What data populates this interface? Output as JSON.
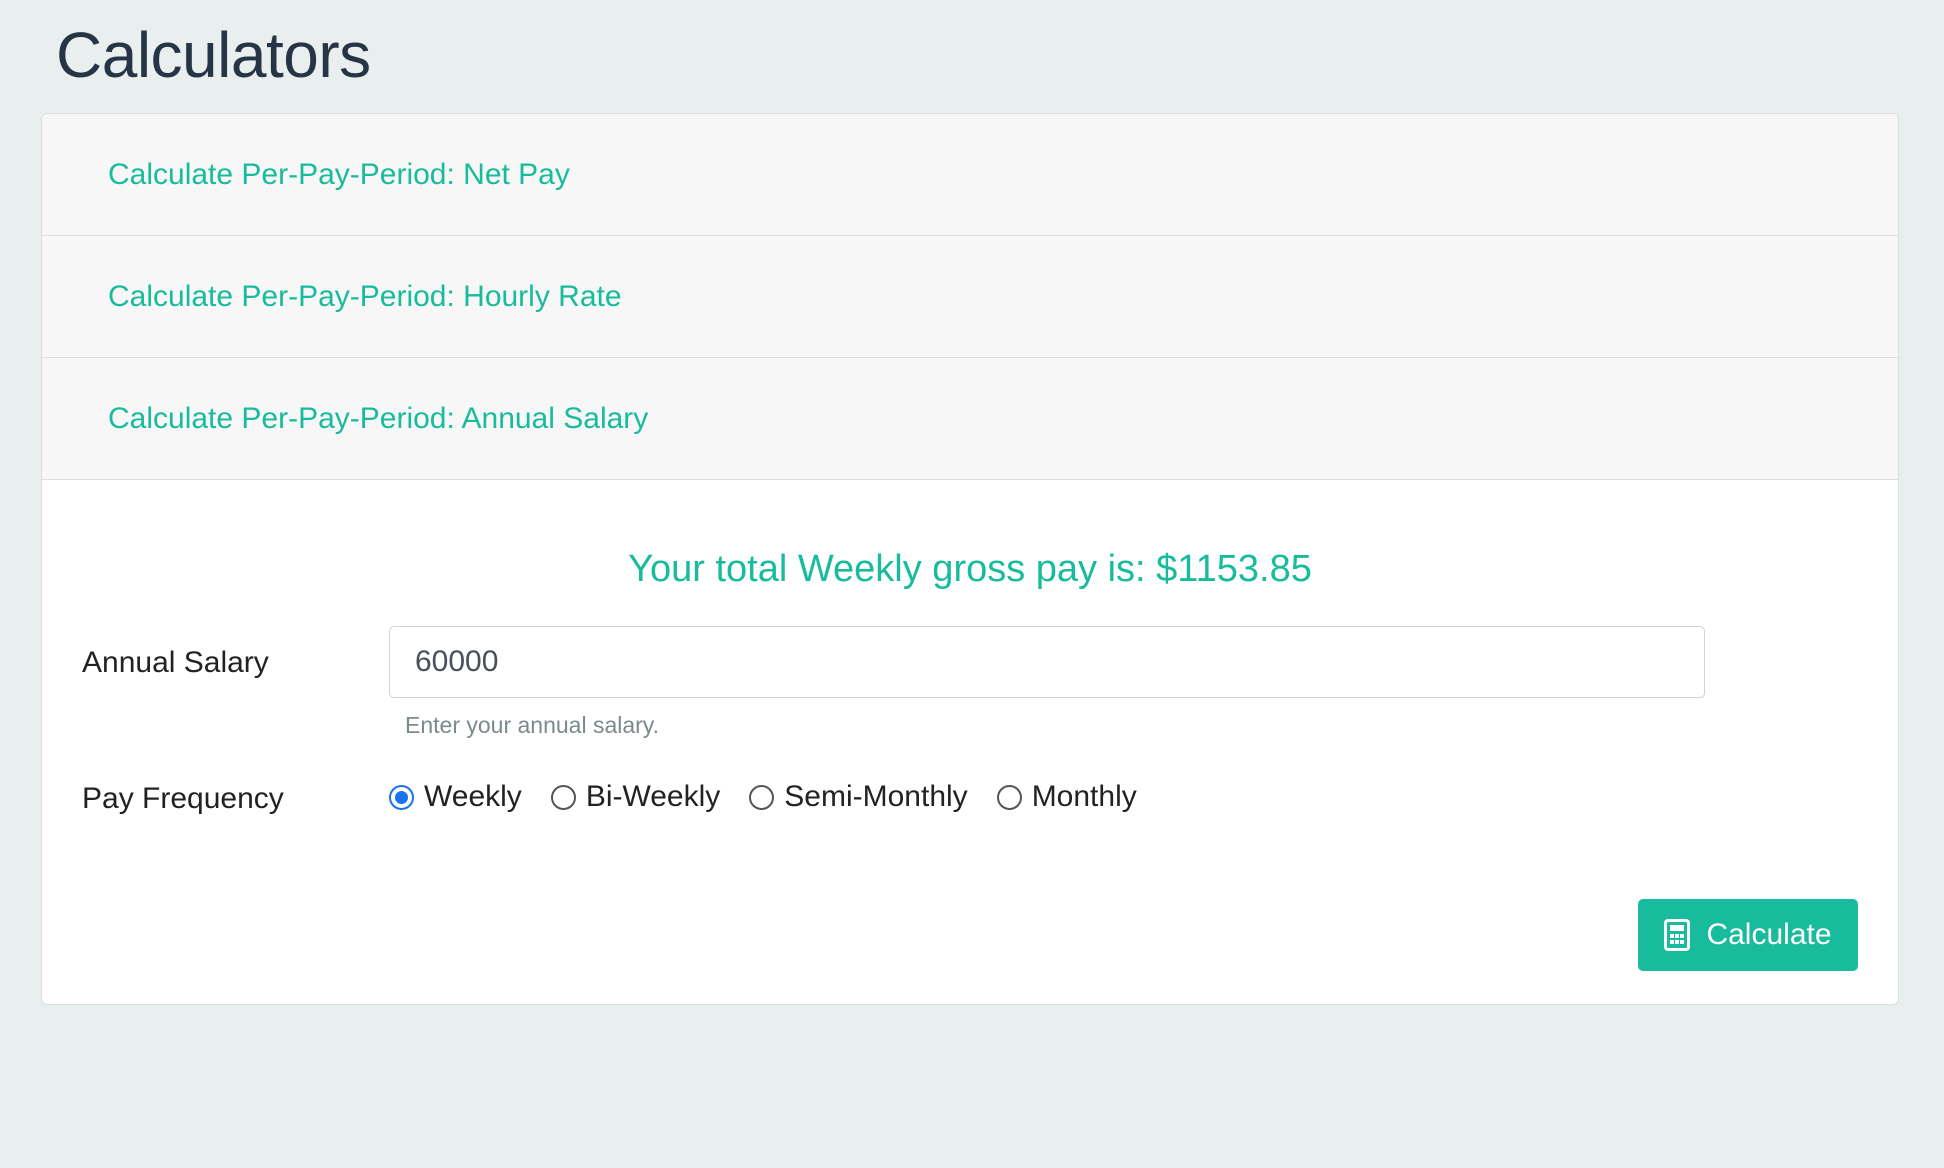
{
  "page": {
    "title": "Calculators"
  },
  "accordion": [
    {
      "label": "Calculate Per-Pay-Period: Net Pay"
    },
    {
      "label": "Calculate Per-Pay-Period: Hourly Rate"
    },
    {
      "label": "Calculate Per-Pay-Period: Annual Salary"
    }
  ],
  "form": {
    "result": "Your total Weekly gross pay is: $1153.85",
    "salary_label": "Annual Salary",
    "salary_value": "60000",
    "salary_help": "Enter your annual salary.",
    "frequency_label": "Pay Frequency",
    "frequency_options": [
      "Weekly",
      "Bi-Weekly",
      "Semi-Monthly",
      "Monthly"
    ],
    "frequency_selected": "Weekly",
    "calculate_label": "Calculate",
    "calculate_icon": "calculator-icon"
  },
  "colors": {
    "accent": "#18bc9c",
    "background": "#e9eeee",
    "title": "#253546",
    "radio_checked": "#1a73e8"
  }
}
